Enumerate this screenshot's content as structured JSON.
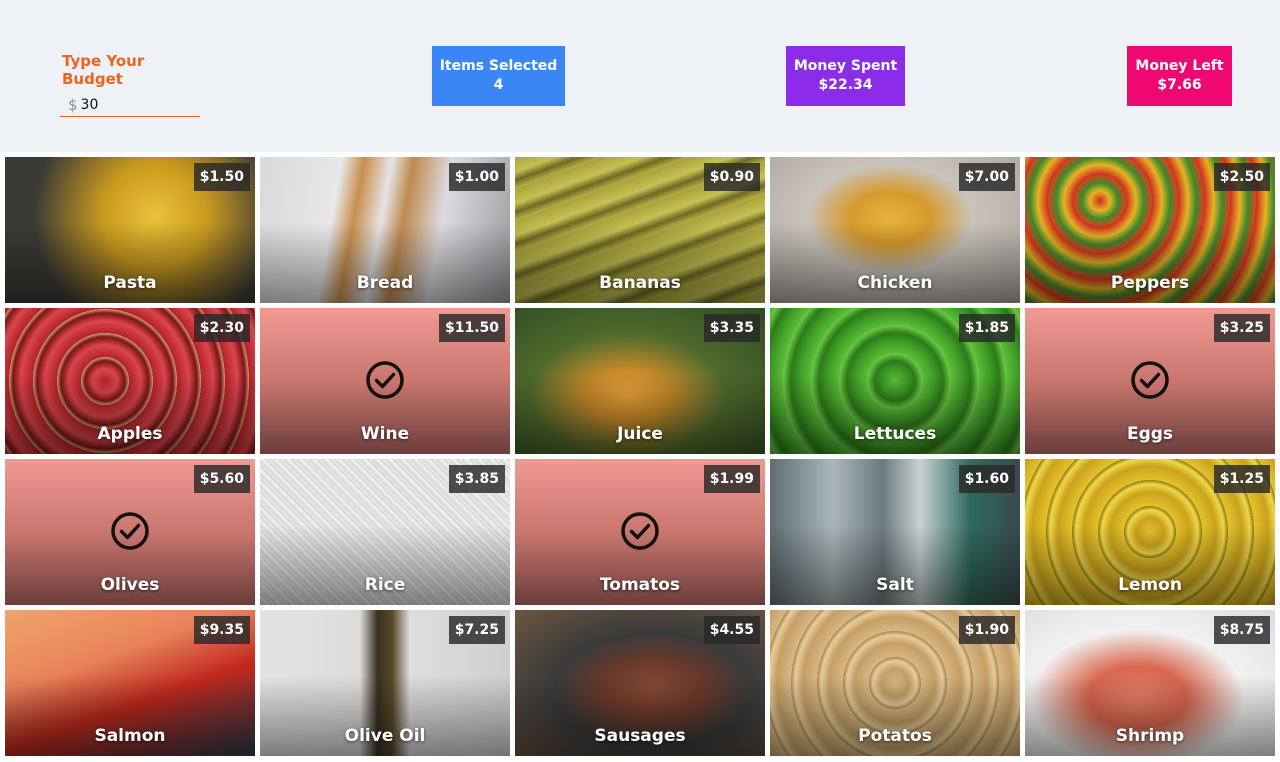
{
  "budget": {
    "label": "Type Your Budget",
    "currency": "$",
    "value": "30"
  },
  "stats": {
    "items_label": "Items Selected",
    "items_value": "4",
    "spent_label": "Money Spent",
    "spent_value": "$22.34",
    "left_label": "Money Left",
    "left_value": "$7.66"
  },
  "colors": {
    "accent_orange": "#f0621e",
    "items_blue": "#3b86f7",
    "spent_purple": "#8a2ce8",
    "left_pink": "#f00872",
    "selected_tile": "#f19a93"
  },
  "products": [
    {
      "name": "Pasta",
      "price": "$1.50",
      "selected": false,
      "bg": "radial-gradient(circle at 60% 40%, #e9c33a 0%, #c99a1e 30%, #3b3a36 70%)"
    },
    {
      "name": "Bread",
      "price": "$1.00",
      "selected": false,
      "bg": "linear-gradient(100deg, #d9d9dc 0%, #e8e7e9 30%, #c98f4e 38%, #e6e4e6 48%, #bf8a50 56%, #dcdbdf 70%, #9a9aa0 100%)"
    },
    {
      "name": "Bananas",
      "price": "$0.90",
      "selected": false,
      "bg": "repeating-linear-gradient(160deg, #a9a23a 0px, #c7c154 14px, #6e6a24 22px, #b8b046 30px)"
    },
    {
      "name": "Chicken",
      "price": "$7.00",
      "selected": false,
      "bg": "radial-gradient(ellipse at 48% 42%, #e8b23c 0%, #d69a2e 22%, #c9c3bb 45%, #a9a39c 100%)"
    },
    {
      "name": "Peppers",
      "price": "$2.50",
      "selected": false,
      "bg": "repeating-radial-gradient(circle at 30% 30%, #cf2a20 0px, #e5b423 10px, #3c8a2c 18px, #d8421c 26px)"
    },
    {
      "name": "Apples",
      "price": "$2.30",
      "selected": false,
      "bg": "repeating-radial-gradient(circle at 40% 50%, #b5202a 0px, #d9464c 12px, #7d1418 20px, #c9a36a 24px)"
    },
    {
      "name": "Wine",
      "price": "$11.50",
      "selected": true,
      "bg": "#f19a93"
    },
    {
      "name": "Juice",
      "price": "$3.35",
      "selected": false,
      "bg": "radial-gradient(ellipse at 45% 60%, #e8a238 0%, #c88a2a 20%, #4e6a2c 50%, #2f4a24 100%)"
    },
    {
      "name": "Lettuces",
      "price": "$1.85",
      "selected": false,
      "bg": "repeating-radial-gradient(circle at 50% 50%, #5bbd3a 0px, #3e9a25 12px, #2d7a1a 20px, #6ccc45 28px)"
    },
    {
      "name": "Eggs",
      "price": "$3.25",
      "selected": true,
      "bg": "#f19a93"
    },
    {
      "name": "Olives",
      "price": "$5.60",
      "selected": true,
      "bg": "#f19a93"
    },
    {
      "name": "Rice",
      "price": "$3.85",
      "selected": false,
      "bg": "repeating-linear-gradient(45deg, #ececec 0px, #d8d8d8 3px, #f4f4f4 6px, #cfcfcf 9px)"
    },
    {
      "name": "Tomatos",
      "price": "$1.99",
      "selected": true,
      "bg": "#f19a93"
    },
    {
      "name": "Salt",
      "price": "$1.60",
      "selected": false,
      "bg": "linear-gradient(90deg, #5e6e72 0%, #aab6ba 25%, #6c7a7e 45%, #c9d2d4 60%, #2e6a5e 80%, #3a4a4c 100%)"
    },
    {
      "name": "Lemon",
      "price": "$1.25",
      "selected": false,
      "bg": "repeating-radial-gradient(circle at 50% 50%, #e5c32b 0px, #caa21c 14px, #f0d84a 22px, #8a7a14 26px)"
    },
    {
      "name": "Salmon",
      "price": "$9.35",
      "selected": false,
      "bg": "linear-gradient(160deg, #f0a46a 0%, #e9835a 35%, #c0281e 60%, #2d3a4a 100%)"
    },
    {
      "name": "Olive Oil",
      "price": "$7.25",
      "selected": false,
      "bg": "linear-gradient(90deg, #e3e3e3 0%, #dcdcdc 40%, #3a3020 47%, #5a4a2a 53%, #dedede 60%, #cfcfcf 100%)"
    },
    {
      "name": "Sausages",
      "price": "$4.55",
      "selected": false,
      "bg": "radial-gradient(ellipse at 55% 55%, #8a4a34 0%, #6b3a2a 25%, #3a3a3a 50%, #6e5640 100%)"
    },
    {
      "name": "Potatos",
      "price": "$1.90",
      "selected": false,
      "bg": "repeating-radial-gradient(circle at 50% 50%, #d8b884 0px, #c49e64 14px, #e6cd9c 22px, #a9844e 26px)"
    },
    {
      "name": "Shrimp",
      "price": "$8.75",
      "selected": false,
      "bg": "radial-gradient(ellipse at 45% 60%, #e8826a 0%, #d9664e 25%, #f2f2f2 55%, #d8dde0 100%)"
    }
  ]
}
